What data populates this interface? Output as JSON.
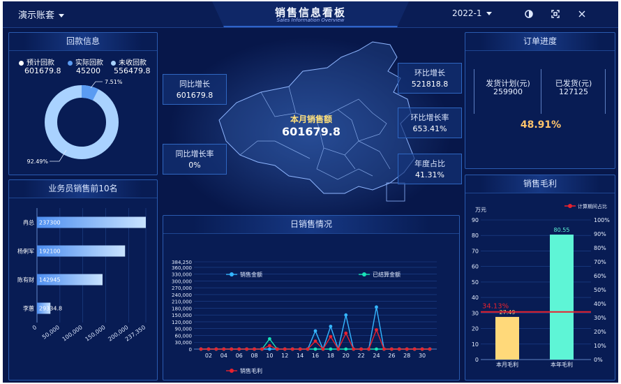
{
  "header": {
    "account_label": "演示账套",
    "title": "销售信息看板",
    "subtitle": "Sales Information Overview",
    "period": "2022-1"
  },
  "collection": {
    "title": "回款信息",
    "legend": [
      {
        "label": "预计回款",
        "value": "601679.8",
        "color": "#ffffff"
      },
      {
        "label": "实际回款",
        "value": "45200",
        "color": "#5b9cf2"
      },
      {
        "label": "未收回款",
        "value": "556479.8",
        "color": "#a9d2ff"
      }
    ],
    "donut": {
      "pct_small": "7.51%",
      "pct_large": "92.49%"
    }
  },
  "center": {
    "label": "本月销售额",
    "value": "601679.8",
    "stats": [
      {
        "label": "同比增长",
        "value": "601679.8"
      },
      {
        "label": "同比增长率",
        "value": "0%"
      },
      {
        "label": "环比增长",
        "value": "521818.8"
      },
      {
        "label": "环比增长率",
        "value": "653.41%"
      },
      {
        "label": "年度占比",
        "value": "41.31%"
      }
    ]
  },
  "order": {
    "title": "订单进度",
    "plan_label": "发货计划(元)",
    "plan_value": "259900",
    "shipped_label": "已发货(元)",
    "shipped_value": "127125",
    "progress": "48.91%"
  },
  "chart_data": [
    {
      "type": "bar",
      "title": "业务员销售前10名",
      "orientation": "horizontal",
      "categories": [
        "冉总",
        "杨俐军",
        "陈有财",
        "李蕙"
      ],
      "values": [
        237300,
        192100,
        142945,
        29334.8
      ],
      "value_labels": [
        "237300",
        "192100",
        "142945",
        "29334.8"
      ],
      "xticks": [
        "0",
        "50,000",
        "100,000",
        "150,000",
        "200,000",
        "237,350"
      ],
      "xlim": [
        0,
        237350
      ]
    },
    {
      "type": "line",
      "title": "日销售情况",
      "x": [
        "01",
        "02",
        "03",
        "04",
        "05",
        "06",
        "07",
        "08",
        "09",
        "10",
        "11",
        "12",
        "13",
        "14",
        "15",
        "16",
        "17",
        "18",
        "19",
        "20",
        "21",
        "22",
        "23",
        "24",
        "25",
        "26",
        "27",
        "28",
        "29",
        "30",
        "31"
      ],
      "xticks": [
        "02",
        "04",
        "06",
        "08",
        "10",
        "12",
        "14",
        "16",
        "18",
        "20",
        "22",
        "24",
        "26",
        "28",
        "30"
      ],
      "yticks": [
        "0",
        "30,000",
        "60,000",
        "90,000",
        "120,000",
        "150,000",
        "180,000",
        "210,000",
        "240,000",
        "270,000",
        "300,000",
        "330,000",
        "360,000",
        "384,250"
      ],
      "ylim": [
        0,
        384250
      ],
      "series": [
        {
          "name": "销售金额",
          "color": "#35b6ff",
          "values": [
            0,
            0,
            0,
            0,
            0,
            0,
            0,
            0,
            0,
            0,
            0,
            0,
            0,
            0,
            0,
            80000,
            0,
            100000,
            0,
            150000,
            0,
            0,
            0,
            185000,
            0,
            0,
            0,
            0,
            0,
            0,
            0
          ]
        },
        {
          "name": "已结算金额",
          "color": "#19e3b8",
          "values": [
            0,
            0,
            0,
            0,
            0,
            0,
            0,
            0,
            0,
            45000,
            0,
            0,
            0,
            0,
            0,
            0,
            0,
            0,
            0,
            0,
            0,
            0,
            0,
            0,
            0,
            0,
            0,
            0,
            0,
            0,
            0
          ]
        },
        {
          "name": "销售毛利",
          "color": "#e8222e",
          "values": [
            0,
            0,
            0,
            0,
            0,
            0,
            0,
            0,
            0,
            15000,
            0,
            0,
            0,
            0,
            0,
            35000,
            0,
            55000,
            0,
            70000,
            0,
            0,
            0,
            85000,
            0,
            0,
            0,
            0,
            0,
            0,
            0
          ]
        }
      ]
    },
    {
      "type": "bar",
      "title": "销售毛利",
      "ylabel": "万元",
      "categories": [
        "本月毛利",
        "本年毛利"
      ],
      "values": [
        27.49,
        80.55
      ],
      "value_labels": [
        "27.49",
        "80.55"
      ],
      "colors": [
        "#ffd97a",
        "#5ef5d6"
      ],
      "ylim": [
        0,
        90
      ],
      "yticks": [
        "0",
        "10",
        "20",
        "30",
        "40",
        "50",
        "60",
        "70",
        "80",
        "90"
      ],
      "y2ticks": [
        "0%",
        "10%",
        "20%",
        "30%",
        "40%",
        "50%",
        "60%",
        "70%",
        "80%",
        "90%",
        "100%"
      ],
      "line": {
        "name": "计算期间占比",
        "value_pct": 34.13,
        "label": "34.13%",
        "color": "#e8222e"
      }
    }
  ]
}
